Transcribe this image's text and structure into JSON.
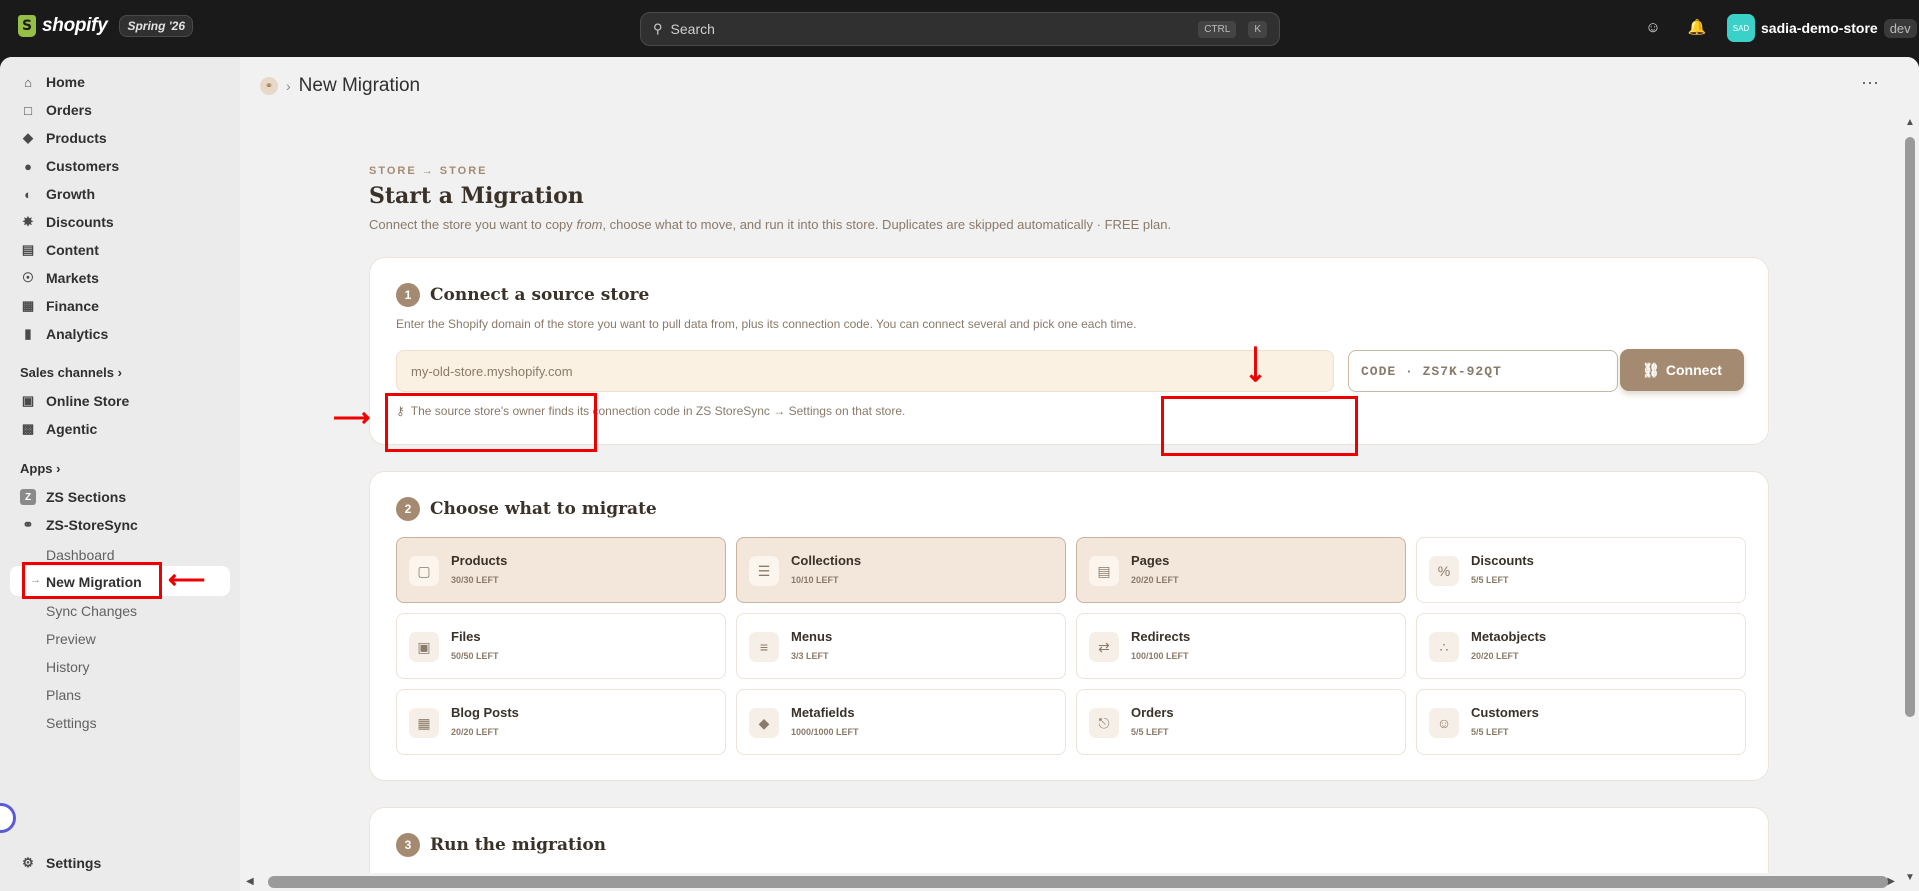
{
  "topbar": {
    "brand": "shopify",
    "edition": "Spring '26",
    "search_placeholder": "Search",
    "search_keys": [
      "CTRL",
      "K"
    ],
    "store_avatar": "SAD",
    "store_name": "sadia-demo-store",
    "store_env": "dev"
  },
  "sidebar": {
    "items": [
      {
        "label": "Home",
        "icon": "home-icon"
      },
      {
        "label": "Orders",
        "icon": "inbox-icon"
      },
      {
        "label": "Products",
        "icon": "tag-icon"
      },
      {
        "label": "Customers",
        "icon": "person-icon"
      },
      {
        "label": "Growth",
        "icon": "gauge-icon"
      },
      {
        "label": "Discounts",
        "icon": "discount-icon"
      },
      {
        "label": "Content",
        "icon": "content-icon"
      },
      {
        "label": "Markets",
        "icon": "globe-icon"
      },
      {
        "label": "Finance",
        "icon": "bank-icon"
      },
      {
        "label": "Analytics",
        "icon": "bar-chart-icon"
      }
    ],
    "sales_channels_label": "Sales channels",
    "channels": [
      {
        "label": "Online Store",
        "icon": "store-icon"
      },
      {
        "label": "Agentic",
        "icon": "agentic-icon"
      }
    ],
    "apps_label": "Apps",
    "apps": [
      {
        "label": "ZS Sections",
        "icon": "zs-sections-icon"
      },
      {
        "label": "ZS-StoreSync",
        "icon": "zs-storesync-icon"
      }
    ],
    "app_subitems": [
      "Dashboard",
      "New Migration",
      "Sync Changes",
      "Preview",
      "History",
      "Plans",
      "Settings"
    ],
    "settings_label": "Settings"
  },
  "header": {
    "title": "New Migration"
  },
  "page": {
    "eyebrow": "STORE → STORE",
    "title": "Start a Migration",
    "lead_before": "Connect the store you want to copy ",
    "lead_em": "from",
    "lead_after": ", choose what to move, and run it into this store. Duplicates are skipped automatically · FREE plan."
  },
  "step1": {
    "number": "1",
    "title": "Connect a source store",
    "description": "Enter the Shopify domain of the store you want to pull data from, plus its connection code. You can connect several and pick one each time.",
    "domain_placeholder": "my-old-store.myshopify.com",
    "code_placeholder": "CODE · ZS7K-92QT",
    "connect_label": "Connect",
    "hint": "The source store's owner finds its connection code in ZS StoreSync → Settings on that store."
  },
  "step2": {
    "number": "2",
    "title": "Choose what to migrate",
    "items": [
      {
        "name": "Products",
        "left": "30/30 LEFT",
        "selected": true,
        "icon": "box-icon"
      },
      {
        "name": "Collections",
        "left": "10/10 LEFT",
        "selected": true,
        "icon": "layers-icon"
      },
      {
        "name": "Pages",
        "left": "20/20 LEFT",
        "selected": true,
        "icon": "page-icon"
      },
      {
        "name": "Discounts",
        "left": "5/5 LEFT",
        "selected": false,
        "icon": "percent-icon"
      },
      {
        "name": "Files",
        "left": "50/50 LEFT",
        "selected": false,
        "icon": "image-icon"
      },
      {
        "name": "Menus",
        "left": "3/3 LEFT",
        "selected": false,
        "icon": "menu-icon"
      },
      {
        "name": "Redirects",
        "left": "100/100 LEFT",
        "selected": false,
        "icon": "shuffle-icon"
      },
      {
        "name": "Metaobjects",
        "left": "20/20 LEFT",
        "selected": false,
        "icon": "metaobjects-icon"
      },
      {
        "name": "Blog Posts",
        "left": "20/20 LEFT",
        "selected": false,
        "icon": "newspaper-icon"
      },
      {
        "name": "Metafields",
        "left": "1000/1000 LEFT",
        "selected": false,
        "icon": "tag-icon"
      },
      {
        "name": "Orders",
        "left": "5/5 LEFT",
        "selected": false,
        "icon": "cart-icon"
      },
      {
        "name": "Customers",
        "left": "5/5 LEFT",
        "selected": false,
        "icon": "users-icon"
      }
    ]
  },
  "step3": {
    "number": "3",
    "title": "Run the migration"
  },
  "colors": {
    "accent": "#a58a72",
    "annotation_red": "#e00000",
    "tile_selected": "#f3e7dc"
  }
}
